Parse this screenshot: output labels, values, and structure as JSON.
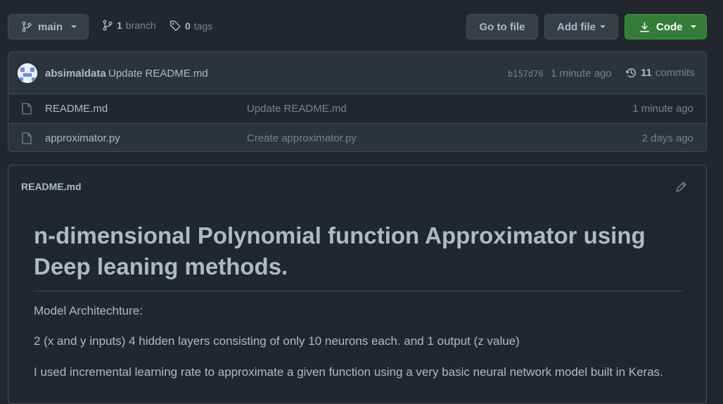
{
  "branch_selector": {
    "label": "main"
  },
  "branches": {
    "count": "1",
    "label": "branch"
  },
  "tags": {
    "count": "0",
    "label": "tags"
  },
  "actions": {
    "go_to_file": "Go to file",
    "add_file": "Add file",
    "code": "Code"
  },
  "latest_commit": {
    "author": "absimaldata",
    "message": "Update README.md",
    "hash": "b157d76",
    "time": "1 minute ago",
    "commit_count": "11",
    "commits_label": "commits"
  },
  "files": [
    {
      "name": "README.md",
      "message": "Update README.md",
      "time": "1 minute ago"
    },
    {
      "name": "approximator.py",
      "message": "Create approximator.py",
      "time": "2 days ago"
    }
  ],
  "readme": {
    "filename": "README.md",
    "title": "n-dimensional Polynomial function Approximator using Deep leaning methods.",
    "paragraphs": [
      "Model Architechture:",
      "2 (x and y inputs) 4 hidden layers consisting of only 10 neurons each. and 1 output (z value)",
      "I used incremental learning rate to approximate a given function using a very basic neural network model built in Keras."
    ]
  },
  "colors": {
    "bg": "#22272e",
    "border": "#444c56",
    "primary": "#347d39",
    "text": "#adbac7",
    "muted": "#768390"
  }
}
